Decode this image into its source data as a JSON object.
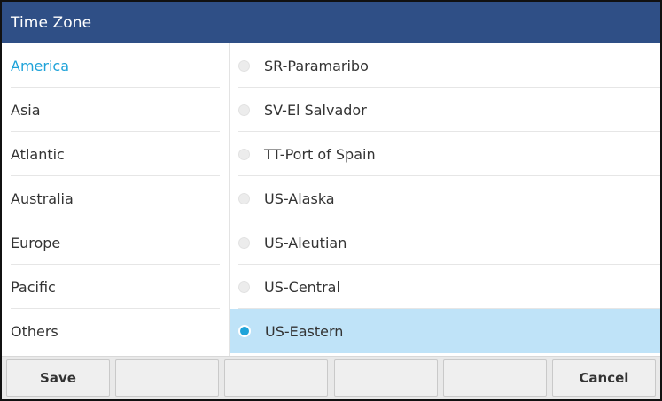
{
  "header": {
    "title": "Time Zone"
  },
  "categories": {
    "items": [
      {
        "label": "America",
        "active": true
      },
      {
        "label": "Asia",
        "active": false
      },
      {
        "label": "Atlantic",
        "active": false
      },
      {
        "label": "Australia",
        "active": false
      },
      {
        "label": "Europe",
        "active": false
      },
      {
        "label": "Pacific",
        "active": false
      },
      {
        "label": "Others",
        "active": false
      }
    ]
  },
  "zones": {
    "items": [
      {
        "label": "SR-Paramaribo",
        "selected": false
      },
      {
        "label": "SV-El Salvador",
        "selected": false
      },
      {
        "label": "TT-Port of Spain",
        "selected": false
      },
      {
        "label": "US-Alaska",
        "selected": false
      },
      {
        "label": "US-Aleutian",
        "selected": false
      },
      {
        "label": "US-Central",
        "selected": false
      },
      {
        "label": "US-Eastern",
        "selected": true
      }
    ]
  },
  "softkeys": {
    "save_label": "Save",
    "key2_label": "",
    "key3_label": "",
    "key4_label": "",
    "key5_label": "",
    "cancel_label": "Cancel"
  },
  "colors": {
    "header_bg": "#2f4f86",
    "active_text": "#1fa3d9",
    "selected_row_bg": "#bfe3f8"
  }
}
